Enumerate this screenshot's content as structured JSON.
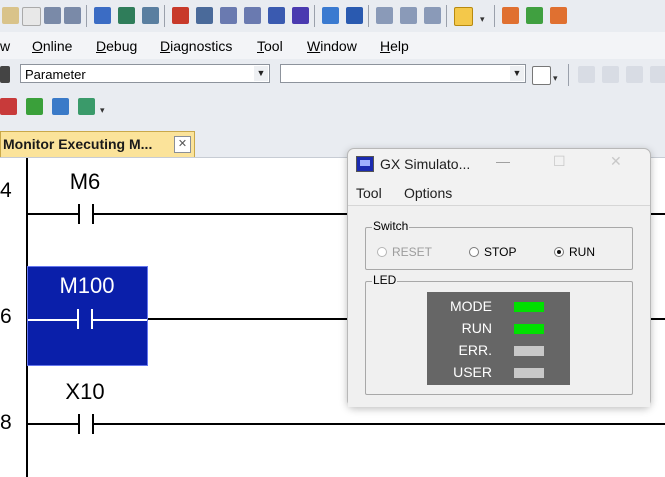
{
  "menubar": {
    "items": [
      {
        "label": "w",
        "u": ""
      },
      {
        "label": "nline",
        "u": "O"
      },
      {
        "label": "ebug",
        "u": "D"
      },
      {
        "label": "iagnostics",
        "u": "D"
      },
      {
        "label": "ool",
        "u": "T"
      },
      {
        "label": "indow",
        "u": "W"
      },
      {
        "label": "elp",
        "u": "H"
      }
    ]
  },
  "toolbar3": {
    "combo1_value": "Parameter",
    "combo2_value": ""
  },
  "tab": {
    "label": "Monitor Executing M...",
    "close": "✕"
  },
  "ladder": {
    "steps": [
      {
        "step": "4",
        "device": "M6"
      },
      {
        "step": "6",
        "device": "M100"
      },
      {
        "step": "8",
        "device": "X10"
      }
    ]
  },
  "simulator": {
    "title": "GX Simulato...",
    "buttons": {
      "minimize": "—",
      "maximize": "☐",
      "close": "✕"
    },
    "menu": [
      "Tool",
      "Options"
    ],
    "switch_group": {
      "label": "Switch",
      "options": [
        {
          "label": "RESET",
          "selected": false,
          "disabled": true
        },
        {
          "label": "STOP",
          "selected": false,
          "disabled": false
        },
        {
          "label": "RUN",
          "selected": true,
          "disabled": false
        }
      ]
    },
    "led_group": {
      "label": "LED",
      "leds": [
        {
          "label": "MODE",
          "color": "#00e000"
        },
        {
          "label": "RUN",
          "color": "#00e000"
        },
        {
          "label": "ERR.",
          "color": "#c8c8c8"
        },
        {
          "label": "USER",
          "color": "#c8c8c8"
        }
      ]
    }
  },
  "colors": {
    "selection": "#0a1faa",
    "tab_active": "#fbe39a",
    "led_panel": "#666666"
  }
}
